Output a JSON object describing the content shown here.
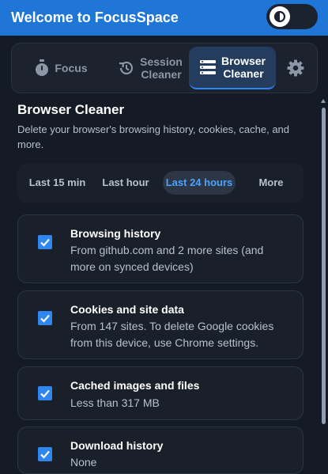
{
  "header": {
    "title": "Welcome to FocusSpace"
  },
  "tabs": [
    {
      "label": "Focus",
      "icon": "stopwatch-icon",
      "active": false
    },
    {
      "label": "Session\nCleaner",
      "icon": "history-icon",
      "active": false
    },
    {
      "label": "Browser\nCleaner",
      "icon": "list-icon",
      "active": true
    }
  ],
  "settings": {
    "icon": "gear-icon"
  },
  "panel": {
    "title": "Browser Cleaner",
    "description": "Delete your browser's browsing history, cookies, cache, and more."
  },
  "time_range": {
    "options": [
      "Last 15 min",
      "Last hour",
      "Last 24 hours",
      "More"
    ],
    "selected": "Last 24 hours"
  },
  "items": [
    {
      "title": "Browsing history",
      "description": "From github.com and 2 more sites (and more on synced devices)",
      "checked": true
    },
    {
      "title": "Cookies and site data",
      "description": "From 147 sites. To delete Google cookies from this device, use Chrome settings.",
      "checked": true
    },
    {
      "title": "Cached images and files",
      "description": "Less than 317 MB",
      "checked": true
    },
    {
      "title": "Download history",
      "description": "None",
      "checked": true
    }
  ],
  "colors": {
    "accent": "#2f86ee",
    "header": "#1f76d6",
    "background": "#151b24"
  }
}
